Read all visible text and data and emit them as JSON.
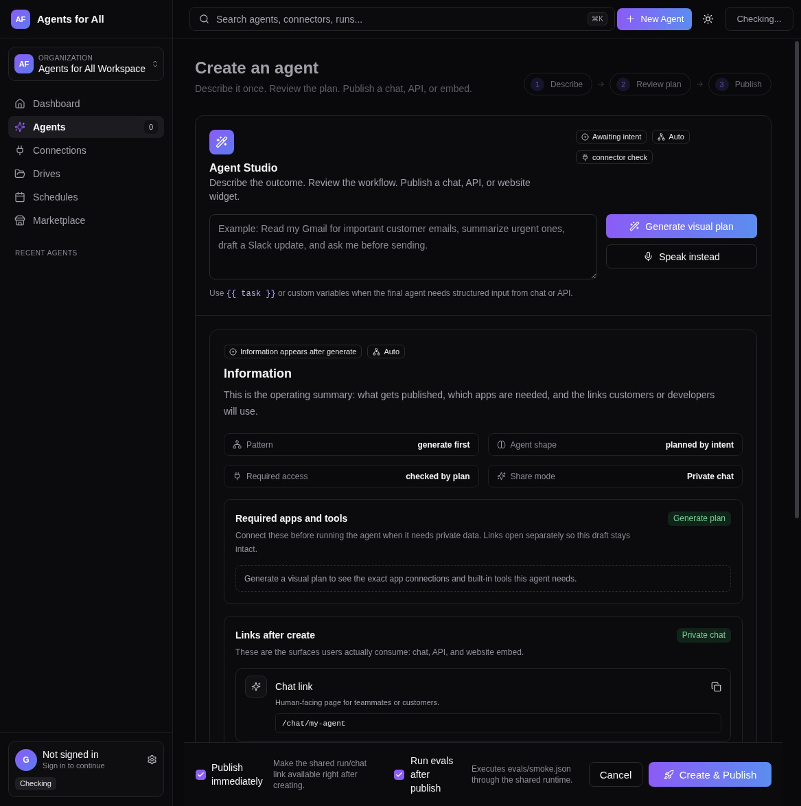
{
  "sidebar": {
    "brand": {
      "initials": "AF",
      "name": "Agents for All"
    },
    "organization": {
      "initials": "AF",
      "label": "ORGANIZATION",
      "name": "Agents for All Workspace"
    },
    "nav": [
      {
        "label": "Dashboard",
        "selected": false
      },
      {
        "label": "Agents",
        "selected": true,
        "count": "0"
      },
      {
        "label": "Connections",
        "selected": false
      },
      {
        "label": "Drives",
        "selected": false
      },
      {
        "label": "Schedules",
        "selected": false
      },
      {
        "label": "Marketplace",
        "selected": false
      }
    ],
    "recent_heading": "RECENT AGENTS",
    "user": {
      "initial": "G",
      "name": "Not signed in",
      "hint": "Sign in to continue",
      "status": "Checking"
    }
  },
  "topbar": {
    "search": {
      "placeholder": "Search agents, connectors, runs...",
      "shortcut": "⌘K"
    },
    "new_button": "New Agent",
    "status_button": "Checking..."
  },
  "header": {
    "title": "Create an agent",
    "subtitle": "Describe it once. Review the plan. Publish a chat, API, or embed.",
    "steps": [
      {
        "number": "1",
        "label": "Describe"
      },
      {
        "number": "2",
        "label": "Review plan"
      },
      {
        "number": "3",
        "label": "Publish"
      }
    ]
  },
  "studio": {
    "title": "Agent Studio",
    "description": "Describe the outcome. Review the workflow. Publish a chat, API, or website widget.",
    "chips": [
      "Awaiting intent",
      "Auto",
      "connector check"
    ],
    "prompt": {
      "placeholder": "Example: Read my Gmail for important customer emails, summarize urgent ones, draft a Slack update, and ask me before sending."
    },
    "generate_button": "Generate visual plan",
    "speak_button": "Speak instead",
    "hint": {
      "before": "Use",
      "code": "{{ task }}",
      "after": "or custom variables when the final agent needs structured input from chat or API."
    }
  },
  "information": {
    "chips": [
      "Information appears after generate",
      "Auto"
    ],
    "title": "Information",
    "description": "This is the operating summary: what gets published, which apps are needed, and the links customers or developers will use.",
    "facts": [
      {
        "label": "Pattern",
        "value": "generate first"
      },
      {
        "label": "Agent shape",
        "value": "planned by intent"
      },
      {
        "label": "Required access",
        "value": "checked by plan"
      },
      {
        "label": "Share mode",
        "value": "Private chat"
      }
    ],
    "required_apps": {
      "title": "Required apps and tools",
      "badge": "Generate plan",
      "description": "Connect these before running the agent when it needs private data. Links open separately so this draft stays intact.",
      "empty_note": "Generate a visual plan to see the exact app connections and built-in tools this agent needs."
    },
    "links": {
      "title": "Links after create",
      "badge": "Private chat",
      "description": "These are the surfaces users actually consume: chat, API, and website embed.",
      "items": [
        {
          "title": "Chat link",
          "description": "Human-facing page for teammates or customers.",
          "path": "/chat/my-agent"
        }
      ]
    }
  },
  "action_bar": {
    "options": [
      {
        "label": "Publish immediately",
        "description": "Make the shared run/chat link available right after creating.",
        "checked": true
      },
      {
        "label": "Run evals after publish",
        "description": "Executes evals/smoke.json through the shared runtime.",
        "checked": true
      }
    ],
    "cancel_button": "Cancel",
    "submit_button": "Create & Publish"
  }
}
